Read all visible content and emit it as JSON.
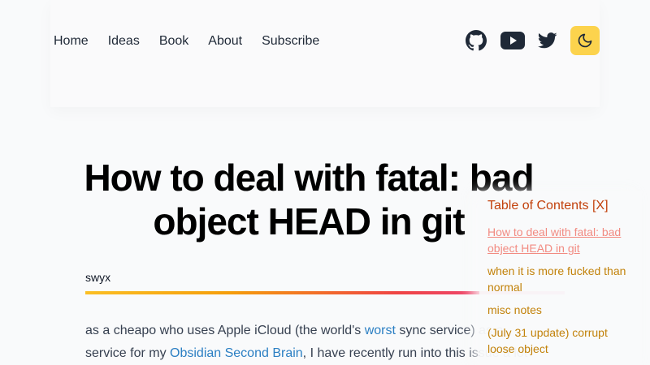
{
  "nav": {
    "items": [
      "Home",
      "Ideas",
      "Book",
      "About",
      "Subscribe"
    ]
  },
  "icons": {
    "github": "github-icon",
    "youtube": "youtube-icon",
    "twitter": "twitter-icon",
    "theme_toggle": "moon-icon",
    "theme_toggle_bg": "#fcd34d"
  },
  "article": {
    "title_line1": "How to deal with fatal: bad",
    "title_line2": "object HEAD in git",
    "author": "swyx",
    "intro": {
      "p1": "as a cheapo who uses Apple iCloud (the world's ",
      "link1": "worst",
      "p2": " sync service) as a",
      "p3": "service for my ",
      "link2": "Obsidian Second Brain",
      "p4": ", I have recently run into this issue a lot"
    }
  },
  "toc": {
    "title": "Table of Contents [X]",
    "items": [
      "How to deal with fatal: bad object HEAD in git",
      "when it is more fucked than normal",
      "misc notes",
      "(July 31 update) corrupt loose object"
    ]
  },
  "colors": {
    "link": "#2b7fc3",
    "toc_title": "#c2410c",
    "toc_item": "#c2820a",
    "toc_active": "#f28b82",
    "gradient": [
      "#fbbf24",
      "#ef4444",
      "#ec4899"
    ]
  }
}
